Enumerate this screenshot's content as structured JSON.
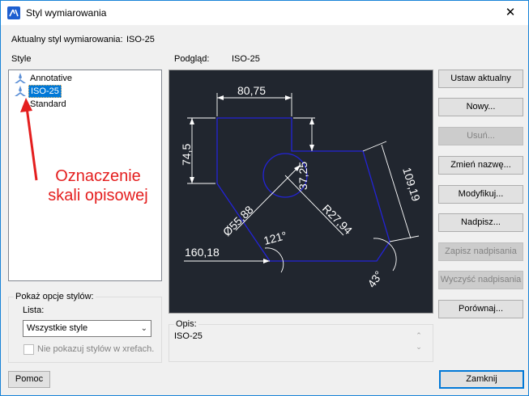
{
  "window": {
    "title": "Styl wymiarowania",
    "close_symbol": "✕"
  },
  "current_style": {
    "label": "Aktualny styl wymiarowania:",
    "value": "ISO-25"
  },
  "styles": {
    "header": "Style",
    "items": [
      {
        "label": "Annotative",
        "icon": "annotative-scale-icon"
      },
      {
        "label": "ISO-25",
        "icon": "annotative-scale-icon",
        "selected": true
      },
      {
        "label": "Standard"
      }
    ]
  },
  "preview": {
    "label": "Podgląd:",
    "style_name": "ISO-25",
    "dimensions": {
      "top": "80,75",
      "left": "74,5",
      "inner": "37,25",
      "right": "109,19",
      "diameter": "Ø55,88",
      "radius": "R27,94",
      "angle": "121°",
      "bottom": "160,18",
      "corner_angle": "43°"
    }
  },
  "annotation": {
    "line1": "Oznaczenie",
    "line2": "skali opisowej",
    "color": "#e41e1e"
  },
  "options": {
    "legend": "Pokaż opcje stylów:",
    "list_label": "Lista:",
    "list_value": "Wszystkie style",
    "xref_checkbox_label": "Nie pokazuj stylów w xrefach.",
    "xref_checked": false
  },
  "description": {
    "legend": "Opis:",
    "text": "ISO-25"
  },
  "buttons": {
    "set_current": "Ustaw aktualny",
    "new": "Nowy...",
    "delete": "Usuń...",
    "rename": "Zmień nazwę...",
    "modify": "Modyfikuj...",
    "override": "Nadpisz...",
    "save_overrides": "Zapisz nadpisania",
    "clear_overrides": "Wyczyść nadpisania",
    "compare": "Porównaj...",
    "help": "Pomoc",
    "close": "Zamknij"
  },
  "colors": {
    "accent": "#0078d7",
    "preview_bg": "#21262f",
    "preview_shape": "#1f1fd0",
    "preview_dims": "#ffffff"
  }
}
